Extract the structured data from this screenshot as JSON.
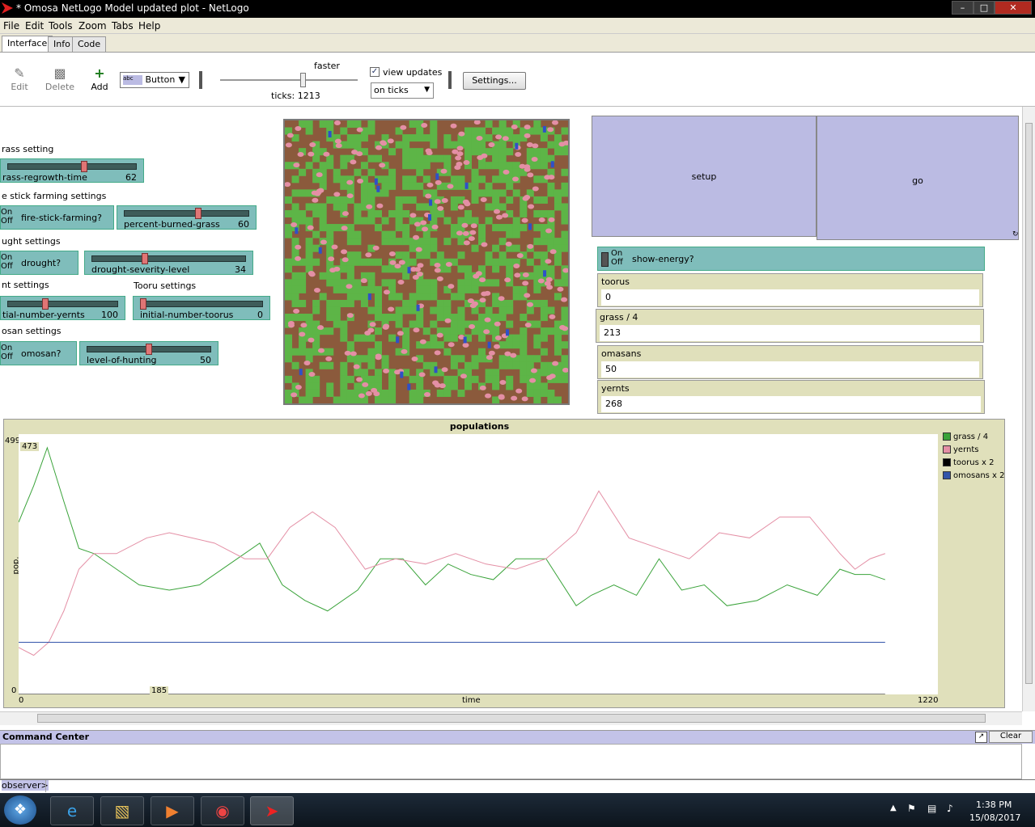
{
  "window": {
    "title": "* Omosa NetLogo Model updated plot - NetLogo"
  },
  "menu": [
    "File",
    "Edit",
    "Tools",
    "Zoom",
    "Tabs",
    "Help"
  ],
  "tabs": [
    "Interface",
    "Info",
    "Code"
  ],
  "toolbar": {
    "edit": "Edit",
    "delete": "Delete",
    "add": "Add",
    "widget_type": "Button",
    "speed_label": "faster",
    "ticks": "ticks: 1213",
    "view_updates": "view updates",
    "update_mode": "on ticks",
    "settings": "Settings..."
  },
  "widgets": {
    "grass_section": "rass setting",
    "grass_regrowth": {
      "name": "rass-regrowth-time",
      "value": "62",
      "fraction": 0.6
    },
    "fire_section": "e stick farming settings",
    "fire_switch": {
      "onoff": "On\nOff",
      "name": "fire-stick-farming?"
    },
    "percent_burned": {
      "name": "percent-burned-grass",
      "value": "60",
      "fraction": 0.6
    },
    "drought_section": "ught settings",
    "drought_switch": {
      "onoff": "On\nOff",
      "name": "drought?"
    },
    "drought_severity": {
      "name": "drought-severity-level",
      "value": "34",
      "fraction": 0.34
    },
    "yernt_section": "nt settings",
    "tooru_section": "Tooru settings",
    "yernts_slider": {
      "name": "tial-number-yernts",
      "value": "100",
      "fraction": 0.33
    },
    "toorus_slider": {
      "name": "initial-number-toorus",
      "value": "0",
      "fraction": 0.0
    },
    "omosan_section": "osan settings",
    "omosan_switch": {
      "onoff": "On\nOff",
      "name": "omosan?"
    },
    "hunting_slider": {
      "name": "level-of-hunting",
      "value": "50",
      "fraction": 0.5
    },
    "setup": "setup",
    "go": "go",
    "show_energy": {
      "onoff": "On\nOff",
      "name": "show-energy?"
    },
    "monitors": [
      {
        "label": "toorus",
        "value": "0"
      },
      {
        "label": "grass / 4",
        "value": "213"
      },
      {
        "label": "omasans",
        "value": "50"
      },
      {
        "label": "yernts",
        "value": "268"
      }
    ]
  },
  "chart_data": {
    "type": "line",
    "title": "populations",
    "xlabel": "time",
    "ylabel": "pop.",
    "xlim": [
      0,
      1220
    ],
    "ylim": [
      0,
      499
    ],
    "y_max_label": "499",
    "y_min_label": "0",
    "x_min_label": "0",
    "x_max_label": "1220",
    "y_peak_marker": "473",
    "x_marker": "185",
    "legend": "right",
    "series": [
      {
        "name": "grass / 4",
        "color": "#3aa33a",
        "x": [
          0,
          20,
          38,
          60,
          80,
          100,
          130,
          160,
          200,
          240,
          280,
          320,
          350,
          380,
          410,
          450,
          480,
          510,
          540,
          570,
          600,
          630,
          660,
          700,
          740,
          760,
          790,
          820,
          850,
          880,
          910,
          940,
          980,
          1020,
          1060,
          1090,
          1110,
          1130,
          1150
        ],
        "y": [
          330,
          400,
          473,
          370,
          280,
          270,
          240,
          210,
          200,
          210,
          250,
          290,
          210,
          180,
          160,
          200,
          260,
          260,
          210,
          250,
          230,
          220,
          260,
          260,
          170,
          190,
          210,
          190,
          260,
          200,
          210,
          170,
          180,
          210,
          190,
          240,
          230,
          230,
          220
        ]
      },
      {
        "name": "yernts",
        "color": "#e48fa5",
        "x": [
          0,
          20,
          40,
          60,
          80,
          100,
          130,
          170,
          200,
          230,
          260,
          300,
          330,
          360,
          390,
          420,
          460,
          500,
          540,
          580,
          620,
          660,
          700,
          740,
          770,
          810,
          850,
          890,
          930,
          970,
          1010,
          1050,
          1090,
          1110,
          1130,
          1150
        ],
        "y": [
          90,
          75,
          100,
          160,
          240,
          270,
          270,
          300,
          310,
          300,
          290,
          260,
          260,
          320,
          350,
          320,
          240,
          260,
          250,
          270,
          250,
          240,
          260,
          310,
          390,
          300,
          280,
          260,
          310,
          300,
          340,
          340,
          270,
          240,
          260,
          270
        ]
      },
      {
        "name": "toorus x 2",
        "color": "#000000",
        "x": [
          0,
          1150
        ],
        "y": [
          0,
          0
        ]
      },
      {
        "name": "omosans x 2",
        "color": "#3355aa",
        "x": [
          0,
          1150
        ],
        "y": [
          100,
          100
        ]
      }
    ]
  },
  "command_center": {
    "title": "Command Center",
    "clear": "Clear",
    "prompt": "observer>"
  },
  "taskbar": {
    "time": "1:38 PM",
    "date": "15/08/2017"
  }
}
